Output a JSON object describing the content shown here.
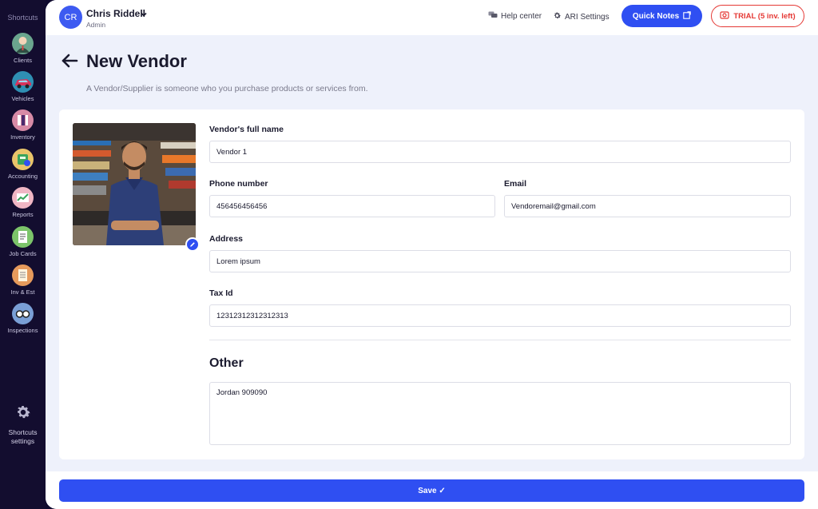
{
  "sidebar": {
    "title": "Shortcuts",
    "items": [
      {
        "label": "Clients",
        "icon": "clients-icon"
      },
      {
        "label": "Vehicles",
        "icon": "vehicles-icon"
      },
      {
        "label": "Inventory",
        "icon": "inventory-icon"
      },
      {
        "label": "Accounting",
        "icon": "accounting-icon"
      },
      {
        "label": "Reports",
        "icon": "reports-icon"
      },
      {
        "label": "Job Cards",
        "icon": "job-cards-icon"
      },
      {
        "label": "Inv & Est",
        "icon": "invoice-estimate-icon"
      },
      {
        "label": "Inspections",
        "icon": "inspections-icon"
      }
    ],
    "settings_line1": "Shortcuts",
    "settings_line2": "settings"
  },
  "header": {
    "avatar_initials": "CR",
    "user_name": "Chris Riddell",
    "user_role": "Admin",
    "help_label": "Help center",
    "settings_label": "ARI Settings",
    "quick_notes_label": "Quick Notes",
    "trial_label": "TRIAL (5 inv. left)"
  },
  "page": {
    "title": "New Vendor",
    "subtitle": "A Vendor/Supplier is someone who you purchase products or services from."
  },
  "form": {
    "full_name_label": "Vendor's full name",
    "full_name_value": "Vendor 1",
    "phone_label": "Phone number",
    "phone_value": "456456456456",
    "email_label": "Email",
    "email_value": "Vendoremail@gmail.com",
    "address_label": "Address",
    "address_value": "Lorem ipsum",
    "tax_label": "Tax Id",
    "tax_value": "12312312312312313",
    "other_title": "Other",
    "other_value": "Jordan 909090"
  },
  "footer": {
    "save_label": "Save ✓"
  },
  "colors": {
    "accent": "#2f4ff2",
    "sidebar": "#130d2f",
    "trial": "#e53935"
  }
}
